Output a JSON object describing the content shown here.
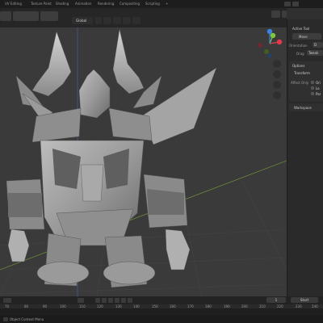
{
  "workspace_tabs": [
    {
      "label": "UV Editing",
      "active": false
    },
    {
      "label": "Texture Paint",
      "active": false
    },
    {
      "label": "Shading",
      "active": false
    },
    {
      "label": "Animation",
      "active": false
    },
    {
      "label": "Rendering",
      "active": false
    },
    {
      "label": "Compositing",
      "active": false
    },
    {
      "label": "Scripting",
      "active": false
    },
    {
      "label": "+",
      "active": false
    }
  ],
  "viewport_header": {
    "orientation_value": "Global"
  },
  "navigation_gizmo": {
    "axis_labels": [
      "X",
      "Y",
      "Z"
    ],
    "colors": {
      "x": "#e2394f",
      "y": "#7ec93a",
      "z": "#3b82e4"
    }
  },
  "sidebar": {
    "active_tool_title": "Active Tool",
    "move_label": "Move",
    "orientation_label": "Orientation",
    "orientation_value": "D",
    "drag_label": "Drag",
    "drag_value": "Tweak",
    "options_title": "Options",
    "transform_title": "Transform",
    "affect_only_label": "Affect Only",
    "affect_checkboxes": [
      "Ori",
      "Lo",
      "Par"
    ],
    "workspace_title": "Workspace"
  },
  "timeline": {
    "current_frame": "1",
    "start_label": "Start",
    "ruler_ticks": [
      "70",
      "80",
      "90",
      "100",
      "110",
      "120",
      "130",
      "140",
      "150",
      "160",
      "170",
      "180",
      "190",
      "200",
      "210",
      "220",
      "230",
      "240",
      "250",
      "260",
      "270",
      "280",
      "290",
      "300",
      "310",
      "320"
    ]
  },
  "status_bar": {
    "context_menu_hint": "Object Context Menu"
  },
  "colors": {
    "accent_blue": "#4772b3",
    "header_bg": "#262626",
    "viewport_bg": "#3a3a3a"
  }
}
